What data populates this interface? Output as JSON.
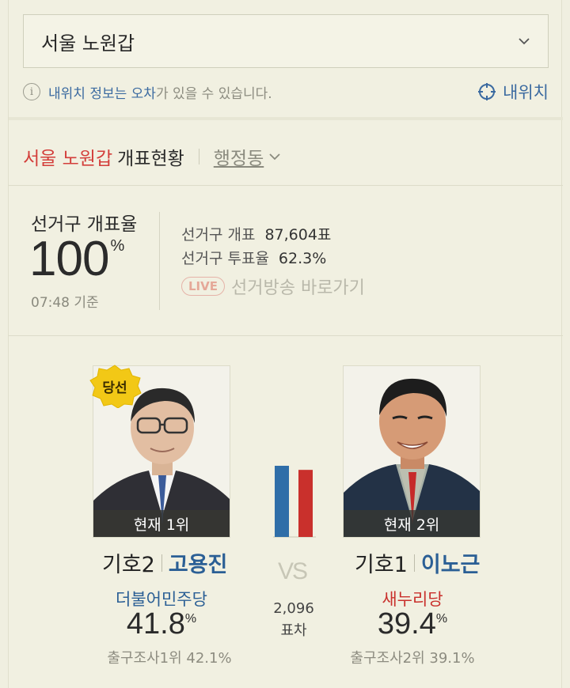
{
  "region_select": {
    "value": "서울 노원갑"
  },
  "notice": {
    "pre": "내위치 정보는 오차",
    "post": "가 있을 수 있습니다.",
    "my_location": "내위치"
  },
  "count_header": {
    "region": "서울 노원갑",
    "title": "개표현황",
    "admin": "행정동"
  },
  "rate": {
    "label": "선거구 개표율",
    "value": "100",
    "unit": "%",
    "time": "07:48 기준"
  },
  "stats": {
    "count_label": "선거구 개표",
    "count_value": "87,604표",
    "turnout_label": "선거구 투표율",
    "turnout_value": "62.3%"
  },
  "live": {
    "badge": "LIVE",
    "label": "선거방송 바로가기"
  },
  "elected_badge": "당선",
  "vs": "VS",
  "difference": {
    "value": "2,096",
    "label": "표차"
  },
  "candidates": [
    {
      "rank": "현재 1위",
      "number": "기호2",
      "name": "고용진",
      "party": "더불어민주당",
      "party_color": "#2b5f95",
      "pct": "41.8",
      "pct_unit": "%",
      "pct_value": 41.8,
      "exit_poll": "출구조사1위 42.1%"
    },
    {
      "rank": "현재 2위",
      "number": "기호1",
      "name": "이노근",
      "party": "새누리당",
      "party_color": "#c9302c",
      "pct": "39.4",
      "pct_unit": "%",
      "pct_value": 39.4,
      "exit_poll": "출구조사2위 39.1%"
    }
  ],
  "colors": {
    "accent_blue": "#3b6aa0",
    "accent_red": "#d33e3a",
    "bar_blue": "#2f6ea8",
    "bar_red": "#c9302c"
  }
}
